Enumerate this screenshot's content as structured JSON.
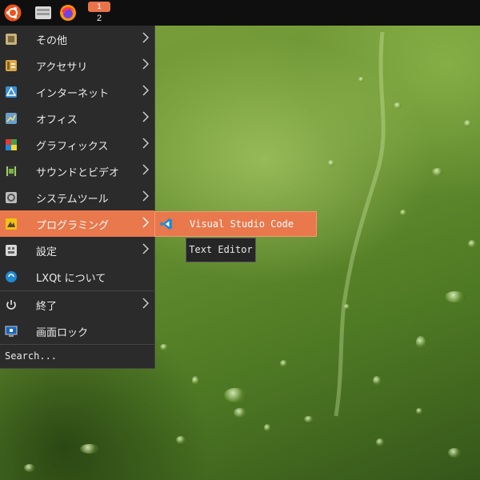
{
  "taskbar": {
    "start_icon": "ubuntu-logo-icon",
    "file_manager_icon": "file-manager-icon",
    "browser_icon": "firefox-icon",
    "workspace_active": "1",
    "workspace_other": "2"
  },
  "menu": {
    "items": [
      {
        "label": "その他",
        "icon": "other-icon"
      },
      {
        "label": "アクセサリ",
        "icon": "accessories-icon"
      },
      {
        "label": "インターネット",
        "icon": "internet-icon"
      },
      {
        "label": "オフィス",
        "icon": "office-icon"
      },
      {
        "label": "グラフィックス",
        "icon": "graphics-icon"
      },
      {
        "label": "サウンドとビデオ",
        "icon": "sound-video-icon"
      },
      {
        "label": "システムツール",
        "icon": "system-tools-icon"
      },
      {
        "label": "プログラミング",
        "icon": "programming-icon"
      },
      {
        "label": "設定",
        "icon": "settings-icon"
      },
      {
        "label": "LXQt について",
        "icon": "lxqt-about-icon"
      },
      {
        "label": "終了",
        "icon": "power-icon"
      },
      {
        "label": "画面ロック",
        "icon": "lock-screen-icon"
      }
    ],
    "search_label": "Search..."
  },
  "submenu": {
    "items": [
      {
        "label": "Visual Studio Code",
        "icon": "vscode-icon"
      }
    ]
  },
  "tooltip": {
    "text": "Text Editor"
  },
  "colors": {
    "accent": "#e9784d",
    "menu_bg": "#2b2b2b",
    "taskbar_bg": "#0f0f0f",
    "vscode_blue": "#1f8ad2"
  }
}
